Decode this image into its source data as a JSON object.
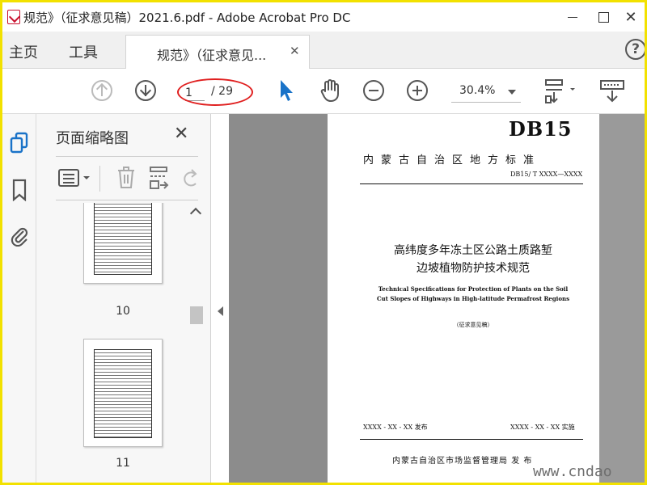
{
  "window": {
    "title": "规范》（征求意见稿）2021.6.pdf - Adobe Acrobat Pro DC",
    "close_glyph": "✕"
  },
  "menu": {
    "home": "主页",
    "tools": "工具"
  },
  "tab": {
    "label": "规范》（征求意见...",
    "close_glyph": "✕"
  },
  "help": {
    "glyph": "?"
  },
  "toolbar": {
    "current_page": "1",
    "total_pages": "/ 29",
    "zoom": "30.4%"
  },
  "thumbnail_panel": {
    "title": "页面缩略图",
    "close_glyph": "✕",
    "thumbnails": [
      {
        "page_label": "10"
      },
      {
        "page_label": "11"
      }
    ]
  },
  "document": {
    "code": "DB15",
    "standard_type": "内蒙古自治区地方标准",
    "standard_number": "DB15/ T XXXX—XXXX",
    "title_line1": "高纬度多年冻土区公路土质路堑",
    "title_line2": "边坡植物防护技术规范",
    "english_line1": "Technical Specifications for Protection of Plants on the Soil",
    "english_line2": "Cut Slopes of Highways in High-latitude Permafrost Regions",
    "draft": "（征求意见稿）",
    "publish_date": "XXXX - XX - XX 发布",
    "implement_date": "XXXX - XX - XX 实施",
    "issuer": "内蒙古自治区市场监督管理局    发  布"
  },
  "watermark": "www.cndao",
  "colors": {
    "frame": "#f2e100",
    "highlight_ellipse": "#e02020",
    "select_tool": "#1a73c8",
    "panel_icon": "#1a73c8"
  }
}
